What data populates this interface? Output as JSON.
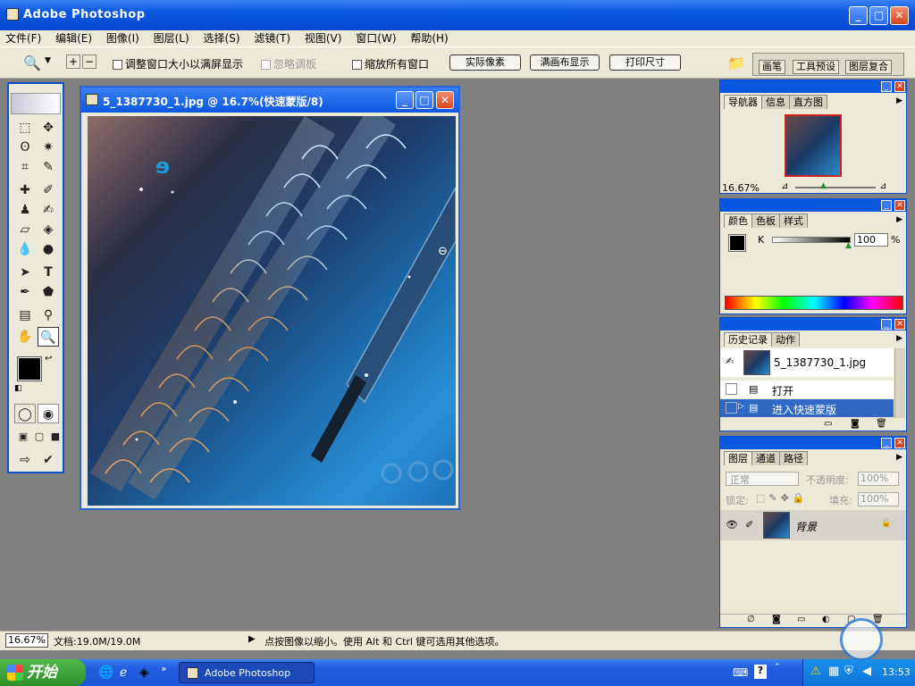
{
  "app": {
    "title": "Adobe Photoshop"
  },
  "menu": [
    "文件(F)",
    "编辑(E)",
    "图像(I)",
    "图层(L)",
    "选择(S)",
    "滤镜(T)",
    "视图(V)",
    "窗口(W)",
    "帮助(H)"
  ],
  "options": {
    "resize_windows": "调整窗口大小以满屏显示",
    "ignore_palettes": "忽略调板",
    "zoom_all": "缩放所有窗口",
    "actual_pixels": "实际像素",
    "fit_screen": "满画布显示",
    "print_size": "打印尺寸",
    "well_tabs": [
      "画笔",
      "工具预设",
      "图层复合"
    ]
  },
  "document": {
    "title": "5_1387730_1.jpg @ 16.7%(快速蒙版/8)"
  },
  "navigator": {
    "tabs": [
      "导航器",
      "信息",
      "直方图"
    ],
    "zoom": "16.67%"
  },
  "color": {
    "tabs": [
      "颜色",
      "色板",
      "样式"
    ],
    "channel": "K",
    "value": "100",
    "unit": "%"
  },
  "history": {
    "tabs": [
      "历史记录",
      "动作"
    ],
    "snapshot": "5_1387730_1.jpg",
    "steps": [
      "打开",
      "进入快速蒙版"
    ]
  },
  "layers": {
    "tabs": [
      "图层",
      "通道",
      "路径"
    ],
    "blend_mode": "正常",
    "opacity_label": "不透明度:",
    "opacity": "100%",
    "lock_label": "锁定:",
    "fill_label": "填充:",
    "fill": "100%",
    "layer_name": "背景"
  },
  "status": {
    "zoom": "16.67%",
    "doc": "文档:19.0M/19.0M",
    "hint": "点按图像以缩小。使用 Alt 和 Ctrl 键可选用其他选项。"
  },
  "taskbar": {
    "start": "开始",
    "task": "Adobe Photoshop",
    "time": "13:53"
  },
  "colors": {
    "xp_blue": "#0a58e0",
    "panel_bg": "#ece9d8",
    "start_green": "#3a9a35",
    "selected_row": "#316ac5"
  }
}
